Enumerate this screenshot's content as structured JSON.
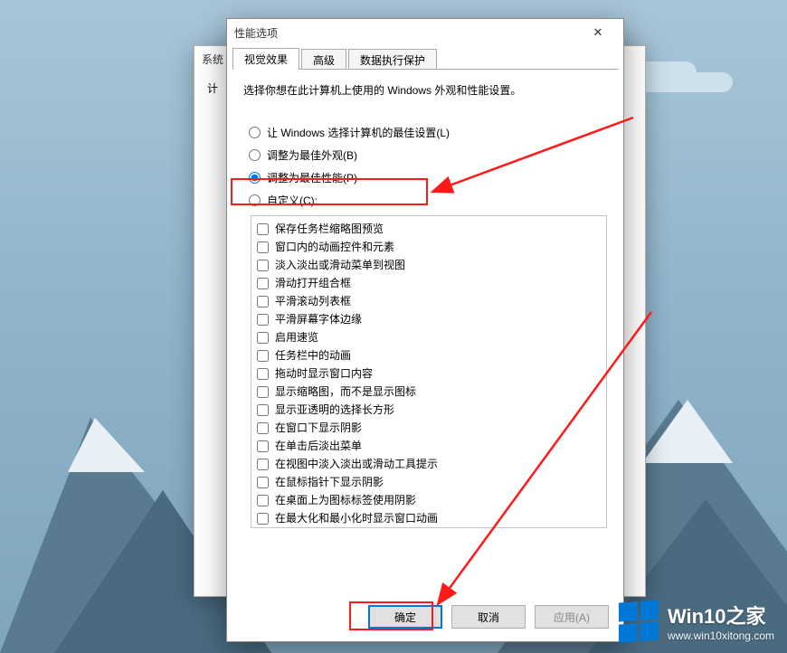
{
  "back_dialog": {
    "title_fragment_left": "系统",
    "title_fragment_left2": "计",
    "close": "✕"
  },
  "dialog": {
    "title": "性能选项",
    "close": "✕",
    "tabs": {
      "visual": "视觉效果",
      "advanced": "高级",
      "dep": "数据执行保护"
    },
    "instruction": "选择你想在此计算机上使用的 Windows 外观和性能设置。",
    "radios": {
      "let_windows": "让 Windows 选择计算机的最佳设置(L)",
      "best_appearance": "调整为最佳外观(B)",
      "best_performance": "调整为最佳性能(P)",
      "custom": "自定义(C):"
    },
    "selected_radio": "best_performance",
    "checkboxes": [
      "保存任务栏缩略图预览",
      "窗口内的动画控件和元素",
      "淡入淡出或滑动菜单到视图",
      "滑动打开组合框",
      "平滑滚动列表框",
      "平滑屏幕字体边缘",
      "启用速览",
      "任务栏中的动画",
      "拖动时显示窗口内容",
      "显示缩略图，而不是显示图标",
      "显示亚透明的选择长方形",
      "在窗口下显示阴影",
      "在单击后淡出菜单",
      "在视图中淡入淡出或滑动工具提示",
      "在鼠标指针下显示阴影",
      "在桌面上为图标标签使用阴影",
      "在最大化和最小化时显示窗口动画"
    ],
    "buttons": {
      "ok": "确定",
      "cancel": "取消",
      "apply": "应用(A)"
    }
  },
  "watermark": {
    "title": "Win10之家",
    "url": "www.win10xitong.com"
  },
  "annotation": {
    "color": "#ff1a1a"
  }
}
